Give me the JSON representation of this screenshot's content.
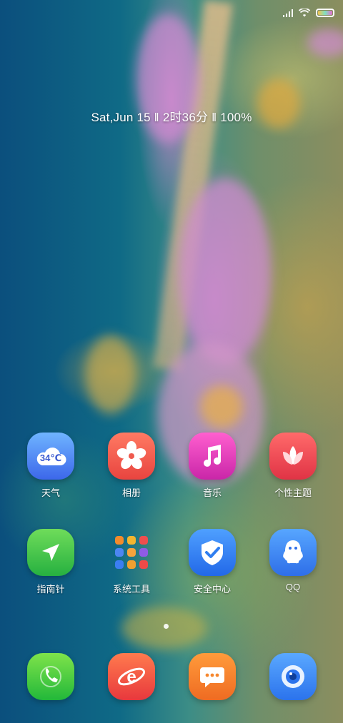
{
  "status_bar": {
    "battery_level": 1.0
  },
  "datetime": "Sat,Jun 15 ‖ 2时36分 ‖ 100%",
  "apps": {
    "weather": {
      "label": "天气",
      "temperature": "34℃"
    },
    "gallery": {
      "label": "相册"
    },
    "music": {
      "label": "音乐"
    },
    "themes": {
      "label": "个性主题"
    },
    "compass": {
      "label": "指南针"
    },
    "system_tools": {
      "label": "系统工具"
    },
    "security": {
      "label": "安全中心"
    },
    "qq": {
      "label": "QQ"
    }
  },
  "dock": {
    "icons": [
      "phone-icon",
      "browser-icon",
      "messages-icon",
      "camera-icon"
    ]
  },
  "colors": {
    "weather": "#4d7ef5",
    "gallery": "#ef5a4e",
    "music": "#e13ab3",
    "themes": "#f05252",
    "compass": "#3ec24d",
    "security": "#2f7ef0",
    "qq": "#3a7ef2",
    "phone": "#3fcb48",
    "browser": "#f05a3c",
    "messages": "#f6872e",
    "camera": "#3d8ff4"
  }
}
